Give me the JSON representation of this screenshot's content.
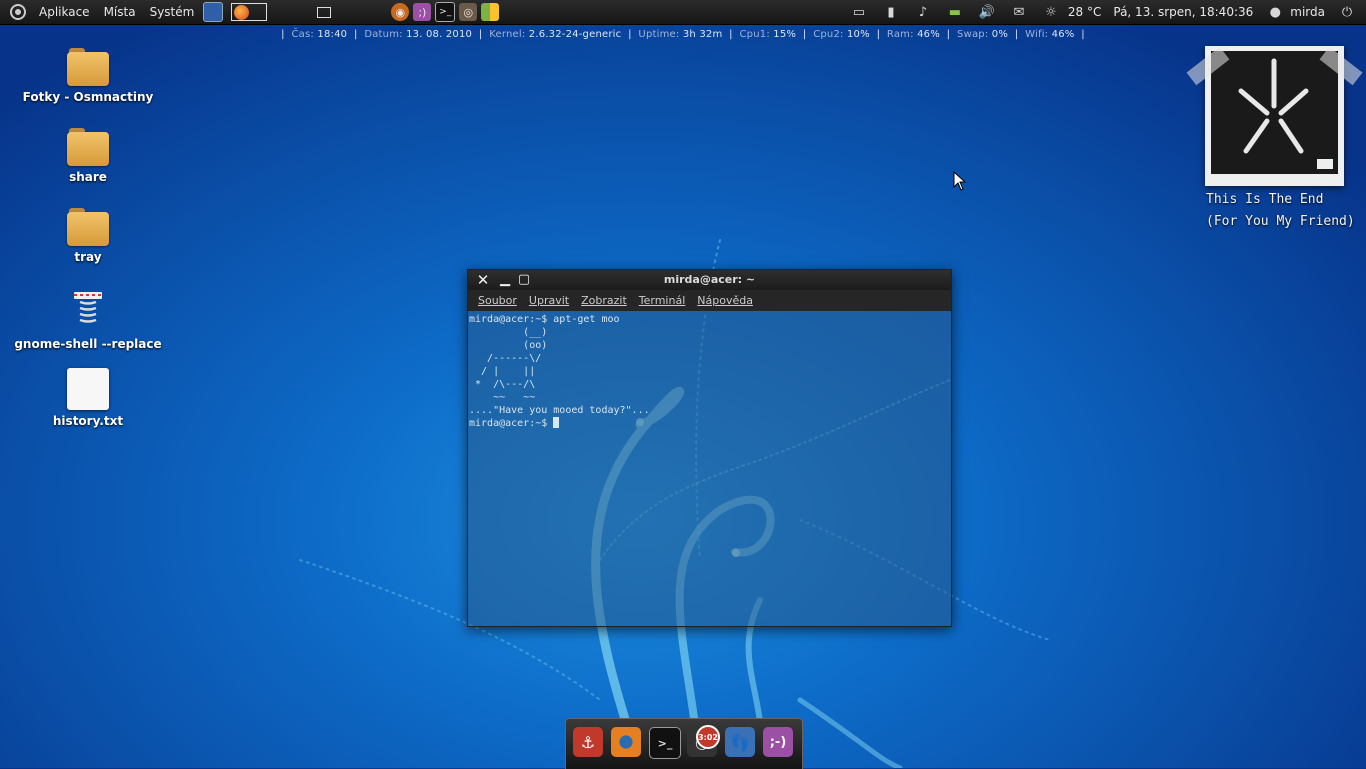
{
  "top_panel": {
    "menus": [
      "Aplikace",
      "Místa",
      "Systém"
    ],
    "weather": "28 °C",
    "datetime": "Pá, 13. srpen, 18:40:36",
    "user": "mirda"
  },
  "conky": [
    {
      "key": "Čas:",
      "val": "18:40"
    },
    {
      "key": "Datum:",
      "val": "13. 08. 2010"
    },
    {
      "key": "Kernel:",
      "val": "2.6.32-24-generic"
    },
    {
      "key": "Uptime:",
      "val": "3h 32m"
    },
    {
      "key": "Cpu1:",
      "val": "15%"
    },
    {
      "key": "Cpu2:",
      "val": "10%"
    },
    {
      "key": "Ram:",
      "val": "46%"
    },
    {
      "key": "Swap:",
      "val": "0%"
    },
    {
      "key": "Wifi:",
      "val": "46%"
    }
  ],
  "desktop_icons": [
    {
      "label": "Fotky - Osmnactiny",
      "icon": "folder-icon"
    },
    {
      "label": "share",
      "icon": "folder-icon"
    },
    {
      "label": "tray",
      "icon": "folder-icon"
    },
    {
      "label": "gnome-shell --replace",
      "icon": "launcher-icon"
    },
    {
      "label": "history.txt",
      "icon": "text-file-icon"
    }
  ],
  "album": {
    "line1": "This Is The End",
    "line2": "(For You My Friend)"
  },
  "terminal": {
    "title": "mirda@acer: ~",
    "menu": [
      "Soubor",
      "Upravit",
      "Zobrazit",
      "Terminál",
      "Nápověda"
    ],
    "lines": [
      "mirda@acer:~$ apt-get moo",
      "         (__)",
      "         (oo)",
      "   /------\\/",
      "  / |    ||",
      " *  /\\---/\\",
      "    ~~   ~~",
      "....\"Have you mooed today?\"...",
      "mirda@acer:~$ "
    ]
  },
  "dock": {
    "items": [
      "anchor-icon",
      "eye-icon",
      "terminal-icon",
      "clock-icon",
      "footprints-icon",
      "chat-icon"
    ],
    "badge": "3:02"
  }
}
